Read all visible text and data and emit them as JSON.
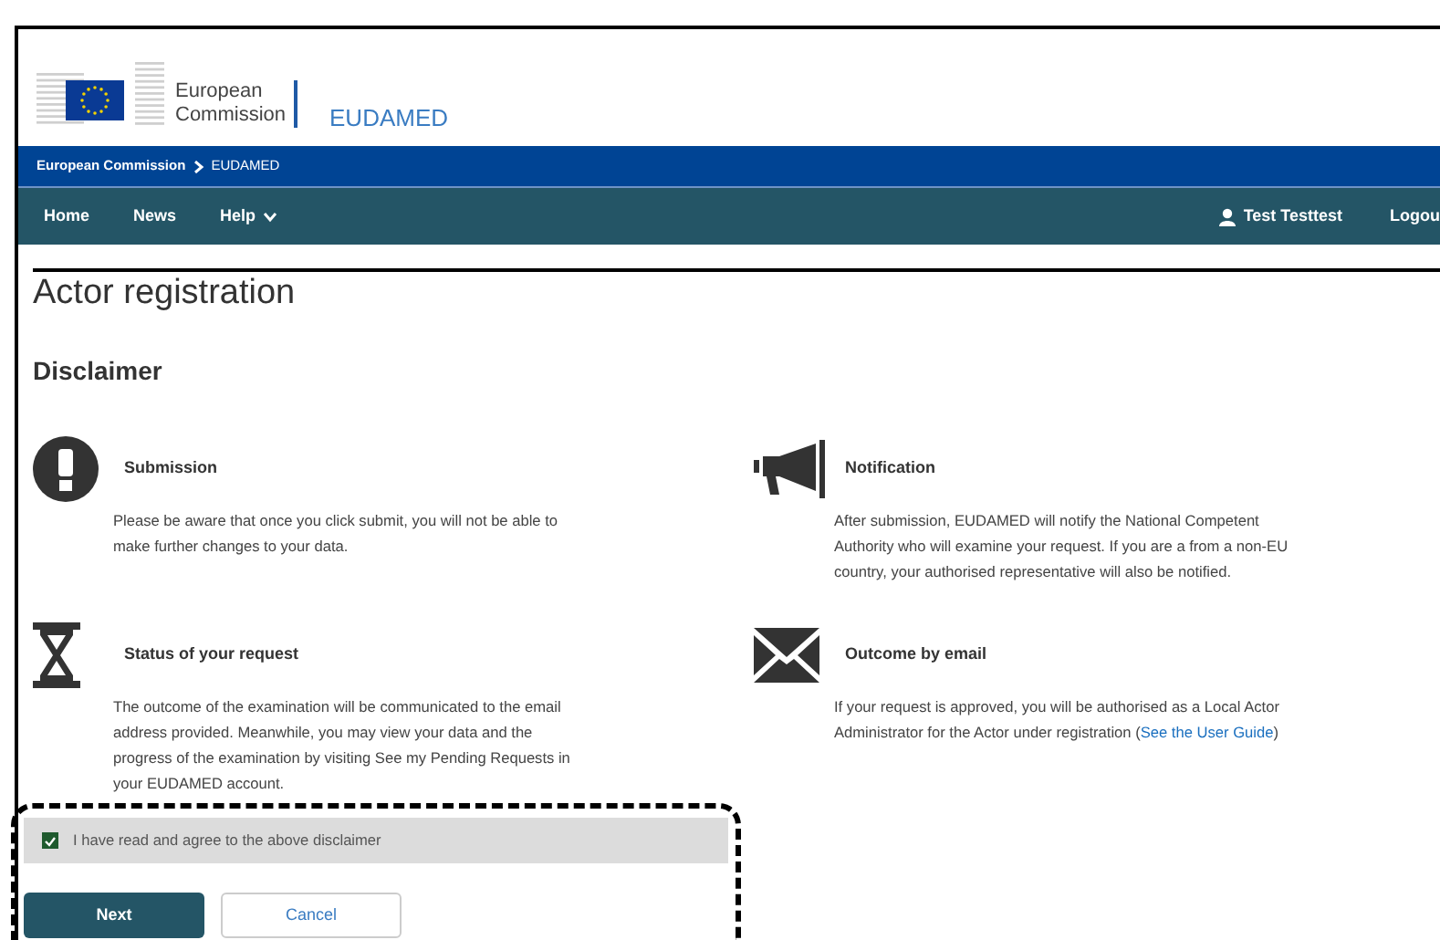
{
  "header": {
    "logo_text": [
      "European",
      "Commission"
    ],
    "site_name": "EUDAMED"
  },
  "breadcrumb": [
    {
      "label": "European Commission"
    },
    {
      "label": "EUDAMED"
    }
  ],
  "nav": {
    "items": [
      {
        "label": "Home",
        "has_menu": false
      },
      {
        "label": "News",
        "has_menu": false
      },
      {
        "label": "Help",
        "has_menu": true
      }
    ],
    "user": "Test Testtest",
    "logout": "Logou"
  },
  "page_title": "Actor registration",
  "section_title": "Disclaimer",
  "sections": [
    {
      "title": "Submission",
      "text": "Please be aware that once you click submit, you will not be able to make further changes to your data."
    },
    {
      "title": "Notification",
      "text": "After submission, EUDAMED will notify the National Competent Authority who will examine your request. If you are a from a non-EU country, your authorised representative will also be notified."
    },
    {
      "title": "Status of your request",
      "text": "The outcome of the examination will be communicated to the email address provided. Meanwhile, you may view your data and the progress of the examination by visiting See my Pending Requests in your EUDAMED account."
    },
    {
      "title": "Outcome by email",
      "text": "If your request is approved, you will be authorised as a Local Actor Administrator for the Actor under registration (",
      "link": "See the User Guide",
      "text_after": ")"
    }
  ],
  "agreement": {
    "label": "I have read and agree to the above disclaimer",
    "checked": true
  },
  "buttons": [
    {
      "label": "Next",
      "kind": "primary"
    },
    {
      "label": "Cancel",
      "kind": "secondary"
    }
  ]
}
